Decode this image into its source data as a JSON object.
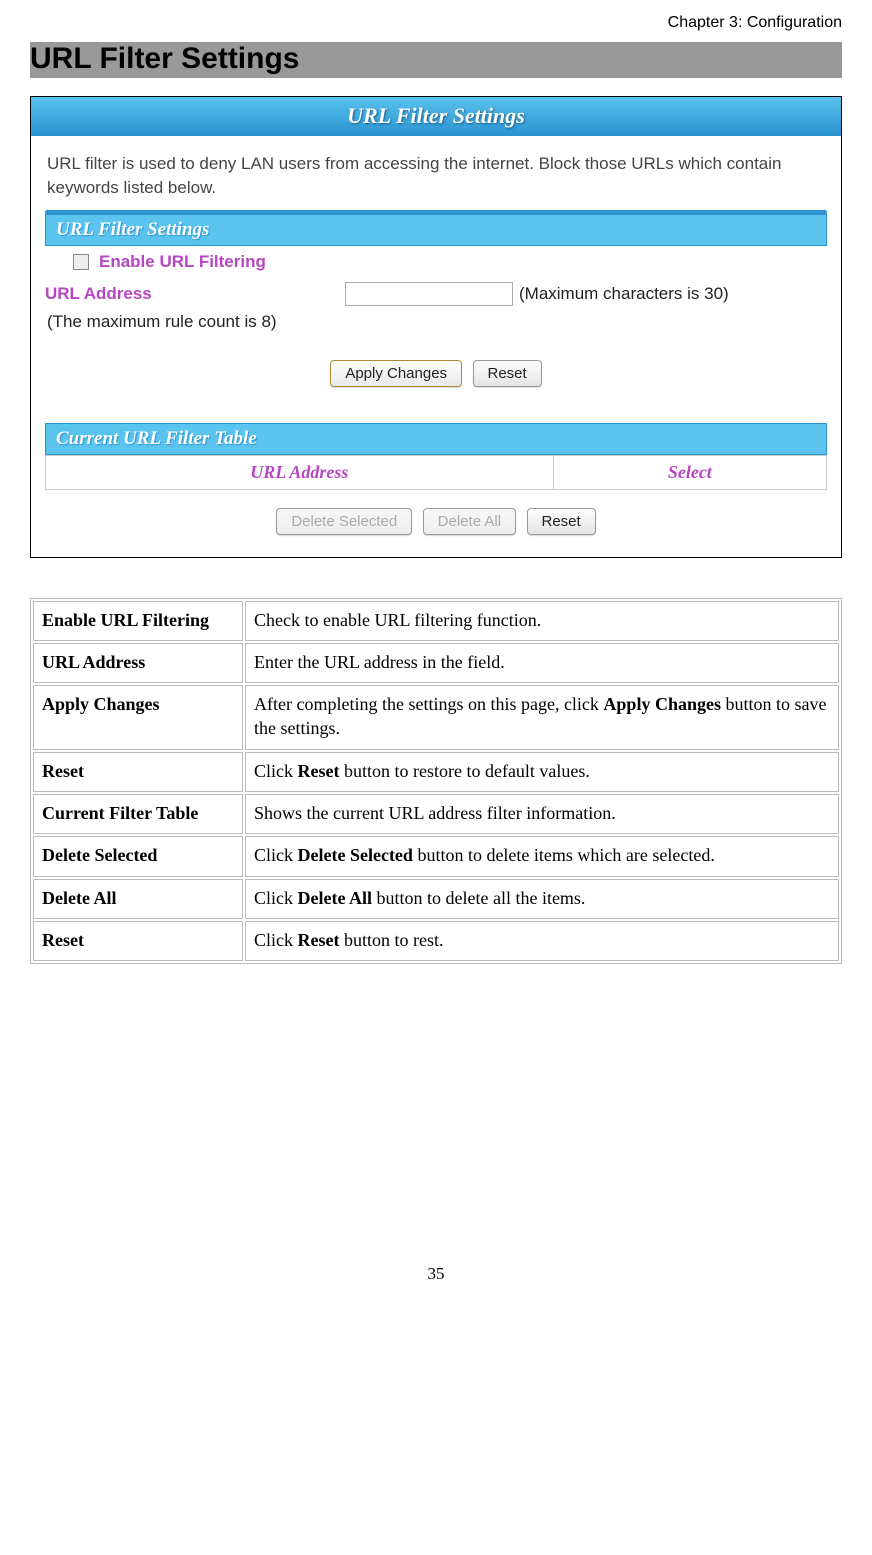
{
  "chapter": "Chapter 3: Configuration",
  "main_title": "URL Filter Settings",
  "screenshot": {
    "title": "URL Filter Settings",
    "intro": "URL filter is used to deny LAN users from accessing the internet. Block those URLs which contain keywords listed below.",
    "section1_title": "URL Filter Settings",
    "enable_label": "Enable URL Filtering",
    "url_label": "URL Address",
    "maxchars": "(Maximum characters is 30)",
    "maxrule": "(The maximum rule count is 8)",
    "apply_btn": "Apply Changes",
    "reset_btn": "Reset",
    "section2_title": "Current URL Filter Table",
    "table_headers": {
      "url": "URL Address",
      "select": "Select"
    },
    "delete_selected_btn": "Delete Selected",
    "delete_all_btn": "Delete All",
    "reset2_btn": "Reset"
  },
  "desc_rows": [
    {
      "term": "Enable URL Filtering",
      "text_pre": "Check to enable URL filtering function.",
      "strong": "",
      "text_post": ""
    },
    {
      "term": "URL Address",
      "text_pre": "Enter the URL address in the field.",
      "strong": "",
      "text_post": ""
    },
    {
      "term": "Apply Changes",
      "text_pre": "After completing the settings on this page, click ",
      "strong": "Apply Changes",
      "text_post": " button to save the settings."
    },
    {
      "term": "Reset",
      "text_pre": "Click ",
      "strong": "Reset",
      "text_post": " button to restore to default values."
    },
    {
      "term": "Current Filter Table",
      "text_pre": "Shows the current URL address filter information.",
      "strong": "",
      "text_post": ""
    },
    {
      "term": "Delete Selected",
      "text_pre": "Click ",
      "strong": "Delete Selected",
      "text_post": " button to delete items which are selected."
    },
    {
      "term": "Delete All",
      "text_pre": "Click ",
      "strong": "Delete All",
      "text_post": " button to delete all the items."
    },
    {
      "term": "Reset",
      "text_pre": "Click ",
      "strong": "Reset",
      "text_post": " button to rest."
    }
  ],
  "page_number": "35"
}
